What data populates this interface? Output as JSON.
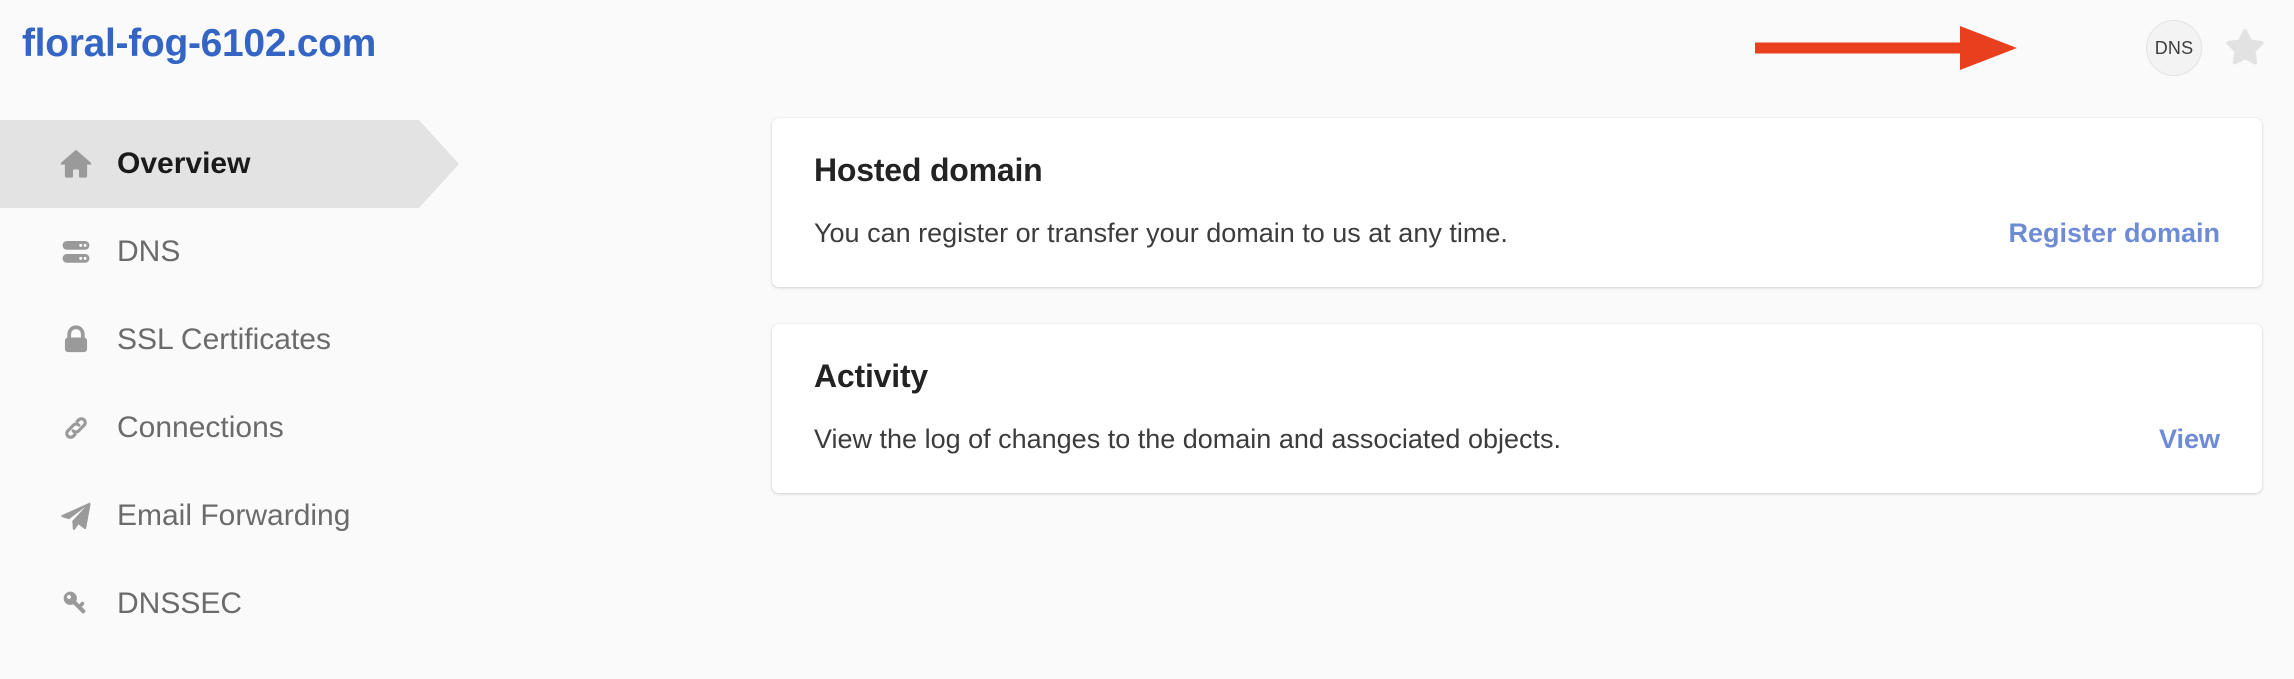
{
  "header": {
    "domain_title": "floral-fog-6102.com",
    "dns_badge_label": "DNS",
    "star_icon_name": "star-icon",
    "annotation_arrow_color": "#e8401f",
    "title_color": "#3465c4"
  },
  "sidebar": {
    "items": [
      {
        "label": "Overview",
        "icon": "home-icon",
        "active": true
      },
      {
        "label": "DNS",
        "icon": "server-icon",
        "active": false
      },
      {
        "label": "SSL Certificates",
        "icon": "lock-icon",
        "active": false
      },
      {
        "label": "Connections",
        "icon": "link-icon",
        "active": false
      },
      {
        "label": "Email Forwarding",
        "icon": "paper-plane-icon",
        "active": false
      },
      {
        "label": "DNSSEC",
        "icon": "key-icon",
        "active": false
      }
    ]
  },
  "main": {
    "cards": [
      {
        "title": "Hosted domain",
        "text": "You can register or transfer your domain to us at any time.",
        "link": "Register domain"
      },
      {
        "title": "Activity",
        "text": "View the log of changes to the domain and associated objects.",
        "link": "View"
      }
    ]
  },
  "colors": {
    "link": "#6e8bd6",
    "active_nav_bg": "#e3e3e3",
    "page_bg": "#fafafa"
  }
}
